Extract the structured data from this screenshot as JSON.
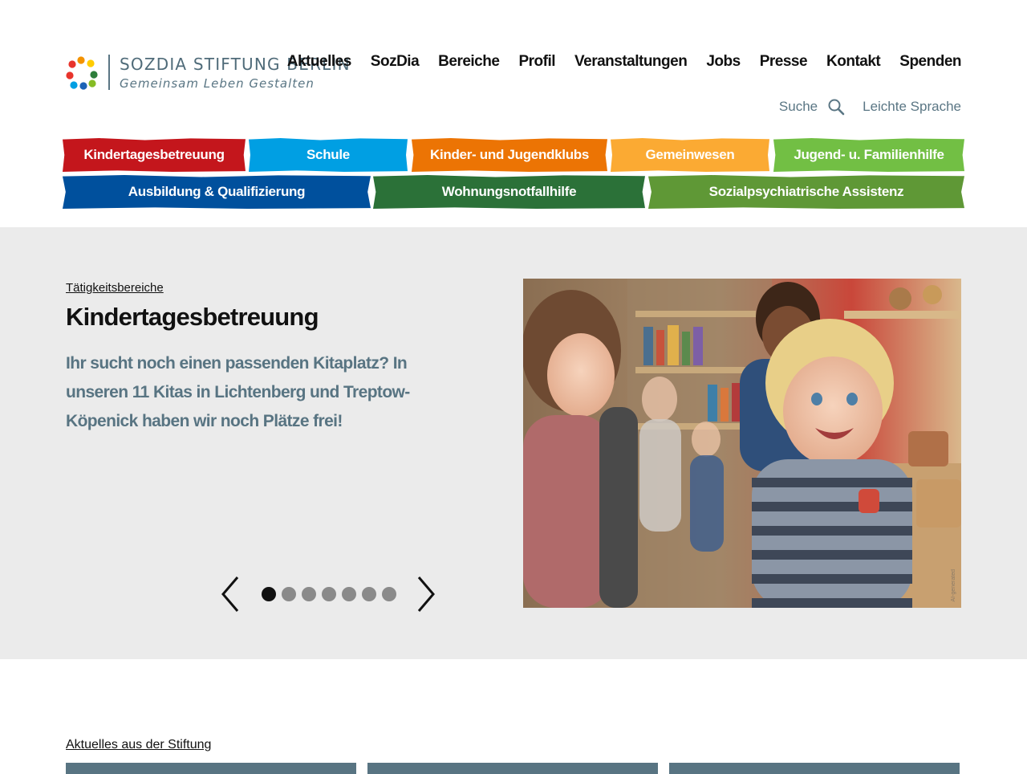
{
  "brand": {
    "name": "SOZDIA STIFTUNG BERLIN",
    "tagline": "Gemeinsam Leben Gestalten",
    "dot_colors": [
      "#e8342c",
      "#f39200",
      "#ffcc00",
      "#e8342c",
      "#2d7d3a",
      "#86bc25",
      "#009fe3",
      "#1c63b7"
    ]
  },
  "main_nav": [
    "Aktuelles",
    "SozDia",
    "Bereiche",
    "Profil",
    "Veranstaltungen",
    "Jobs",
    "Presse",
    "Kontakt",
    "Spenden"
  ],
  "utility_nav": {
    "search_label": "Suche",
    "search_icon": "magnifier-icon",
    "easy_language_label": "Leichte Sprache"
  },
  "categories": [
    {
      "label": "Kindertagesbetreuung",
      "color": "#c4161c"
    },
    {
      "label": "Schule",
      "color": "#009fe3"
    },
    {
      "label": "Kinder- und Jugendklubs",
      "color": "#ec7404"
    },
    {
      "label": "Gemeinwesen",
      "color": "#fbaa33"
    },
    {
      "label": "Jugend- u. Familienhilfe",
      "color": "#72bf44"
    },
    {
      "label": "Ausbildung & Qualifizierung",
      "color": "#00509d"
    },
    {
      "label": "Wohnungsnotfallhilfe",
      "color": "#2b7138"
    },
    {
      "label": "Sozialpsychiatrische Assistenz",
      "color": "#5f9836"
    }
  ],
  "hero": {
    "kicker": "Tätigkeitsbereiche",
    "title": "Kindertagesbetreuung",
    "text": "Ihr sucht noch einen passenden Kitaplatz? In unseren 11 Kitas in Lichtenberg und Treptow-Köpenick haben wir noch Plätze frei!",
    "slide_count": 7,
    "active_slide": 1,
    "image_credit": "AI-generated"
  },
  "news": {
    "heading": "Aktuelles aus der Stiftung",
    "strip_color": "#587482"
  }
}
